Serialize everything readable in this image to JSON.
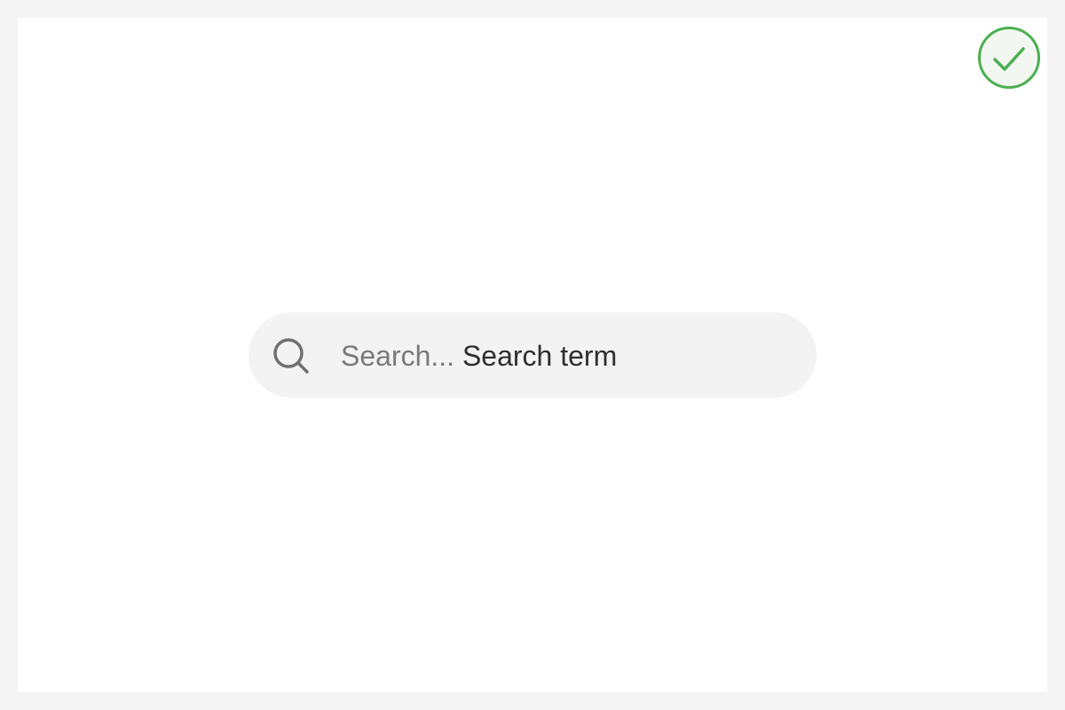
{
  "search": {
    "placeholder": "Search...",
    "value": "Search term"
  },
  "icons": {
    "search": "search-icon",
    "status": "check-circle-icon"
  },
  "colors": {
    "success": "#4caf50",
    "field_background": "#f3f3f3",
    "placeholder_text": "#7a7a7a",
    "value_text": "#2f2f2f"
  }
}
